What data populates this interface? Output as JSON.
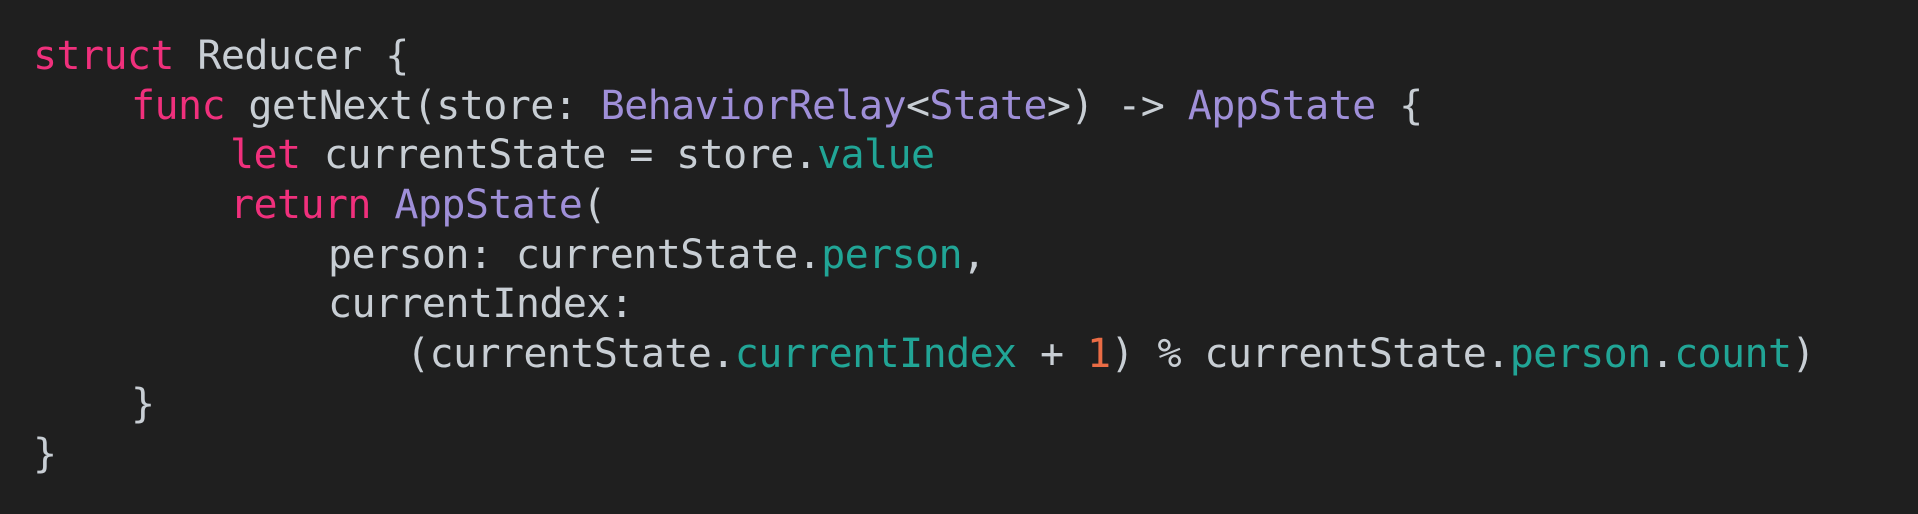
{
  "colors": {
    "background": "#1f1f1f",
    "plain": "#c8ced4",
    "keyword": "#f0307c",
    "type": "#9f8fd8",
    "property": "#21a596",
    "number": "#ea6c45"
  },
  "code": {
    "lines": [
      [
        {
          "text": "struct",
          "kind": "keyword"
        },
        {
          "text": " Reducer {",
          "kind": "plain"
        }
      ],
      [
        {
          "text": "func",
          "kind": "keyword"
        },
        {
          "text": " getNext(store: ",
          "kind": "plain"
        },
        {
          "text": "BehaviorRelay",
          "kind": "type"
        },
        {
          "text": "<",
          "kind": "plain"
        },
        {
          "text": "State",
          "kind": "type"
        },
        {
          "text": ">) -> ",
          "kind": "plain"
        },
        {
          "text": "AppState",
          "kind": "type"
        },
        {
          "text": " {",
          "kind": "plain"
        }
      ],
      [
        {
          "text": "let",
          "kind": "keyword"
        },
        {
          "text": " currentState = store.",
          "kind": "plain"
        },
        {
          "text": "value",
          "kind": "property"
        }
      ],
      [
        {
          "text": "return",
          "kind": "keyword"
        },
        {
          "text": " ",
          "kind": "plain"
        },
        {
          "text": "AppState",
          "kind": "type"
        },
        {
          "text": "(",
          "kind": "plain"
        }
      ],
      [
        {
          "text": "person: currentState.",
          "kind": "plain"
        },
        {
          "text": "person",
          "kind": "property"
        },
        {
          "text": ",",
          "kind": "plain"
        }
      ],
      [
        {
          "text": "currentIndex:",
          "kind": "plain"
        }
      ],
      [
        {
          "text": "(currentState.",
          "kind": "plain"
        },
        {
          "text": "currentIndex",
          "kind": "property"
        },
        {
          "text": " + ",
          "kind": "plain"
        },
        {
          "text": "1",
          "kind": "number"
        },
        {
          "text": ") % currentState.",
          "kind": "plain"
        },
        {
          "text": "person",
          "kind": "property"
        },
        {
          "text": ".",
          "kind": "plain"
        },
        {
          "text": "count",
          "kind": "property"
        },
        {
          "text": ")",
          "kind": "plain"
        }
      ],
      [
        {
          "text": "}",
          "kind": "plain"
        }
      ],
      [
        {
          "text": "}",
          "kind": "plain"
        }
      ]
    ]
  }
}
